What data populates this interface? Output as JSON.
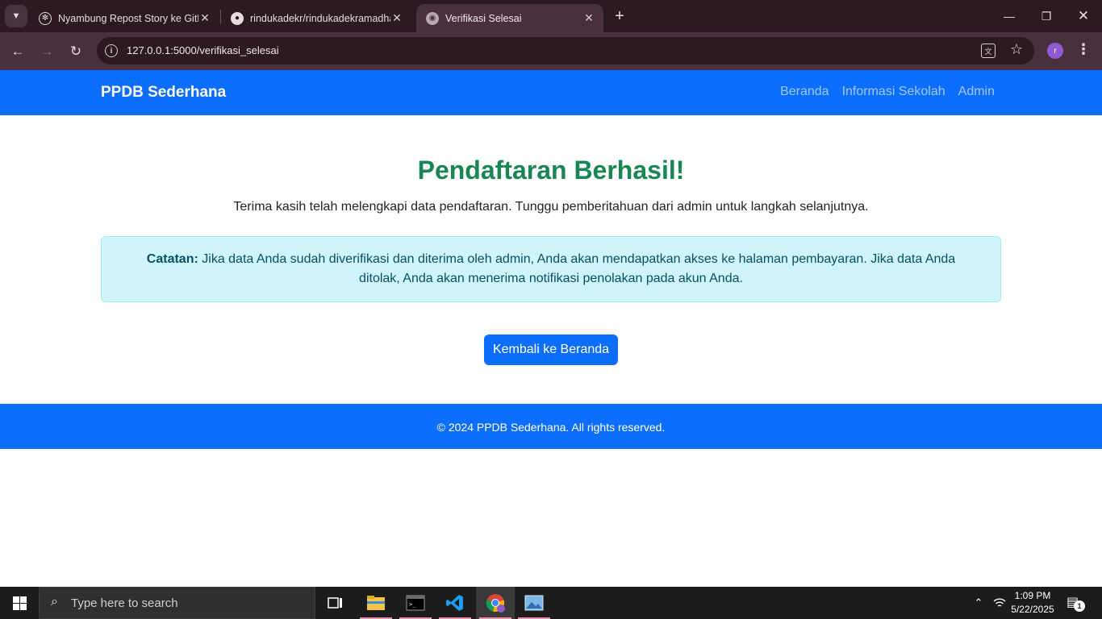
{
  "browser": {
    "tabs": [
      {
        "title": "Nyambung Repost Story ke GitHub",
        "favicon": "openai-icon"
      },
      {
        "title": "rindukadekr/rindukadekramadhan",
        "favicon": "github-icon"
      },
      {
        "title": "Verifikasi Selesai",
        "favicon": "globe-icon",
        "active": true
      }
    ],
    "url": "127.0.0.1:5000/verifikasi_selesai",
    "profile_initial": "r"
  },
  "page": {
    "brand": "PPDB Sederhana",
    "nav_links": [
      "Beranda",
      "Informasi Sekolah",
      "Admin"
    ],
    "heading": "Pendaftaran Berhasil!",
    "lead": "Terima kasih telah melengkapi data pendaftaran. Tunggu pemberitahuan dari admin untuk langkah selanjutnya.",
    "alert_label": "Catatan:",
    "alert_text": " Jika data Anda sudah diverifikasi dan diterima oleh admin, Anda akan mendapatkan akses ke halaman pembayaran. Jika data Anda ditolak, Anda akan menerima notifikasi penolakan pada akun Anda.",
    "button": "Kembali ke Beranda",
    "footer": "© 2024 PPDB Sederhana. All rights reserved."
  },
  "colors": {
    "primary": "#0d6efd",
    "success": "#198754",
    "alert_bg": "#cff4fc",
    "alert_text": "#055160"
  },
  "taskbar": {
    "search_placeholder": "Type here to search",
    "time": "1:09 PM",
    "date": "5/22/2025",
    "notification_count": "1"
  }
}
